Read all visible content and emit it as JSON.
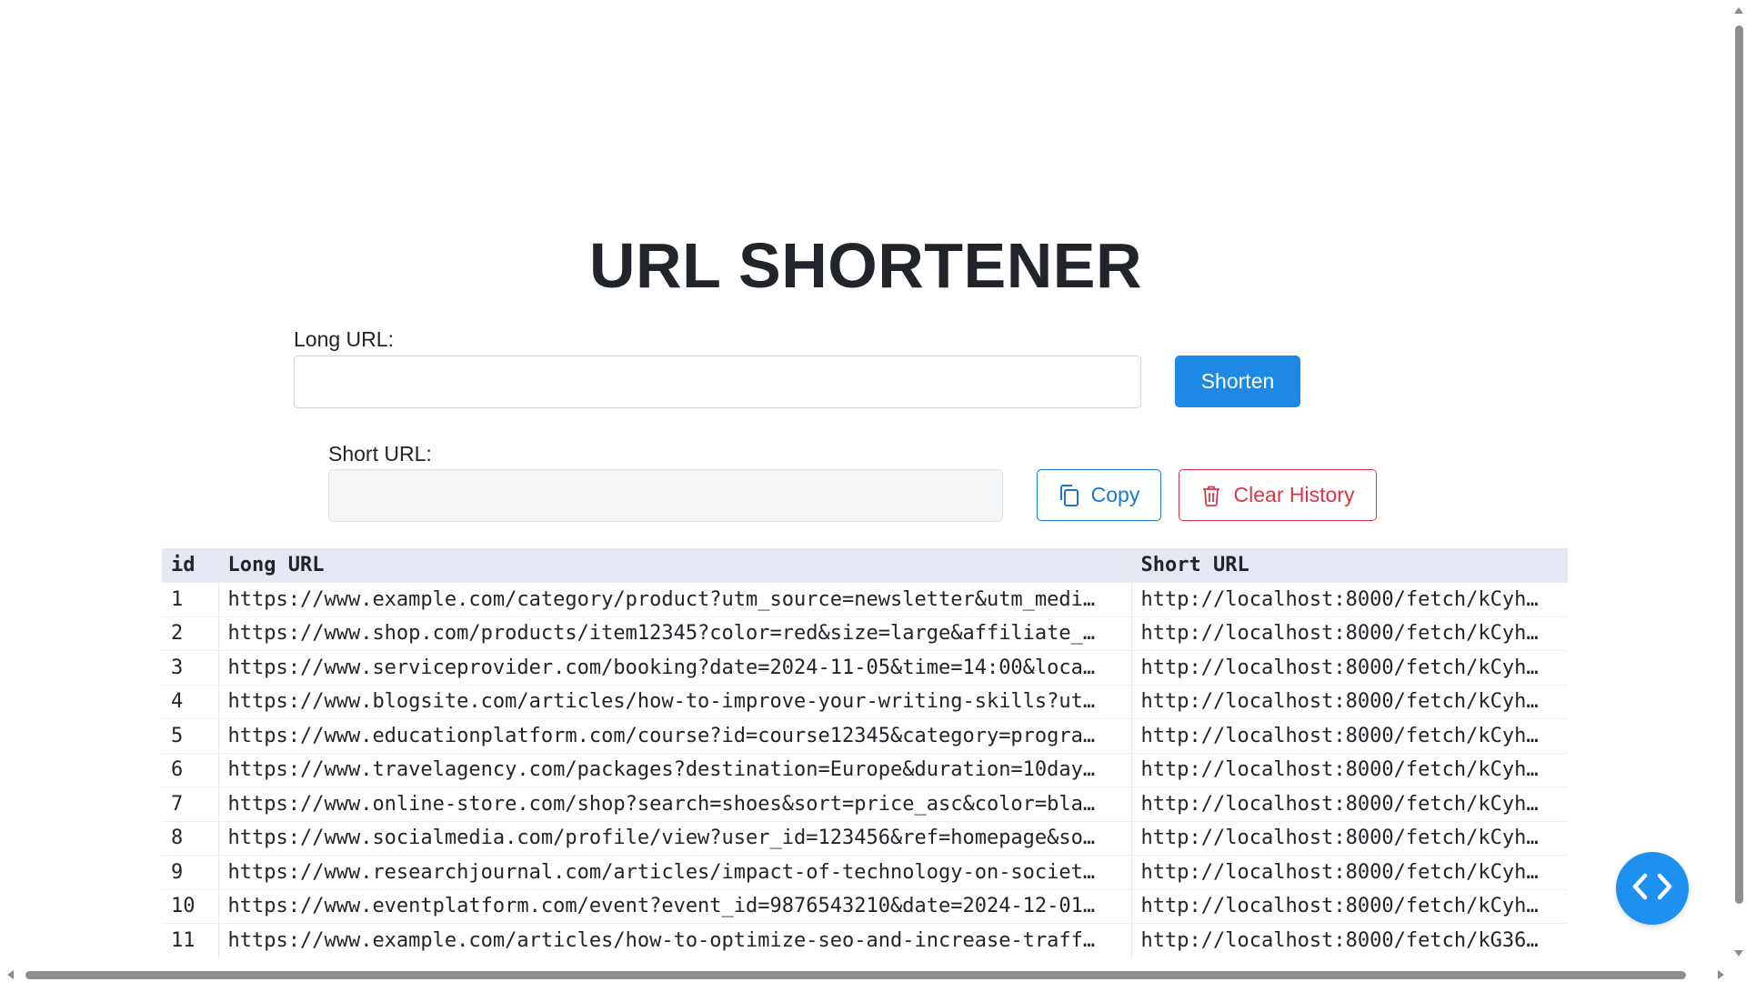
{
  "app": {
    "title": "URL SHORTENER"
  },
  "form": {
    "long_label": "Long URL:",
    "long_value": "",
    "long_placeholder": "",
    "shorten_label": "Shorten",
    "short_label": "Short URL:",
    "short_value": "",
    "copy_label": "Copy",
    "clear_label": "Clear History"
  },
  "table": {
    "headers": {
      "id": "id",
      "long": "Long URL",
      "short": "Short URL"
    },
    "rows": [
      {
        "id": "1",
        "long": "https://www.example.com/category/product?utm_source=newsletter&utm_medi…",
        "short": "http://localhost:8000/fetch/kCyh…"
      },
      {
        "id": "2",
        "long": "https://www.shop.com/products/item12345?color=red&size=large&affiliate_…",
        "short": "http://localhost:8000/fetch/kCyh…"
      },
      {
        "id": "3",
        "long": "https://www.serviceprovider.com/booking?date=2024-11-05&time=14:00&loca…",
        "short": "http://localhost:8000/fetch/kCyh…"
      },
      {
        "id": "4",
        "long": "https://www.blogsite.com/articles/how-to-improve-your-writing-skills?ut…",
        "short": "http://localhost:8000/fetch/kCyh…"
      },
      {
        "id": "5",
        "long": "https://www.educationplatform.com/course?id=course12345&category=progra…",
        "short": "http://localhost:8000/fetch/kCyh…"
      },
      {
        "id": "6",
        "long": "https://www.travelagency.com/packages?destination=Europe&duration=10day…",
        "short": "http://localhost:8000/fetch/kCyh…"
      },
      {
        "id": "7",
        "long": "https://www.online-store.com/shop?search=shoes&sort=price_asc&color=bla…",
        "short": "http://localhost:8000/fetch/kCyh…"
      },
      {
        "id": "8",
        "long": "https://www.socialmedia.com/profile/view?user_id=123456&ref=homepage&so…",
        "short": "http://localhost:8000/fetch/kCyh…"
      },
      {
        "id": "9",
        "long": "https://www.researchjournal.com/articles/impact-of-technology-on-societ…",
        "short": "http://localhost:8000/fetch/kCyh…"
      },
      {
        "id": "10",
        "long": "https://www.eventplatform.com/event?event_id=9876543210&date=2024-12-01…",
        "short": "http://localhost:8000/fetch/kCyh…"
      },
      {
        "id": "11",
        "long": "https://www.example.com/articles/how-to-optimize-seo-and-increase-traff…",
        "short": "http://localhost:8000/fetch/kG36…"
      }
    ]
  },
  "icons": {
    "copy": "copy-icon",
    "clear": "trash-icon",
    "fab": "code-icon"
  },
  "colors": {
    "primary": "#1e88e5",
    "danger": "#dc3545",
    "table_header": "#e3e8f2"
  }
}
